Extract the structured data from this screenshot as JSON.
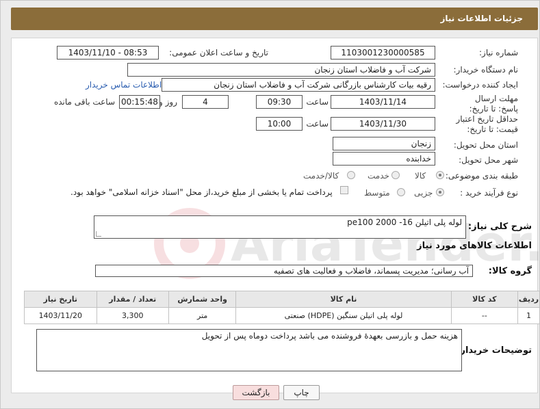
{
  "header": {
    "title": "جزئیات اطلاعات نیاز"
  },
  "fields": {
    "need_number_label": "شماره نیاز:",
    "need_number": "1103001230000585",
    "announce_label": "تاریخ و ساعت اعلان عمومی:",
    "announce_value": "1403/11/10 - 08:53",
    "buyer_label": "نام دستگاه خریدار:",
    "buyer_value": "شرکت آب و فاضلاب استان زنجان",
    "creator_label": "ایجاد کننده درخواست:",
    "creator_value": "رقیه بیات کارشناس بازرگانی شرکت آب و فاضلاب استان زنجان",
    "contact_link": "اطلاعات تماس خریدار",
    "deadline_label": "مهلت ارسال پاسخ: تا تاریخ:",
    "deadline_date": "1403/11/14",
    "time_label": "ساعت",
    "deadline_time": "09:30",
    "days_value": "4",
    "days_label": "روز و",
    "remaining_value": "00:15:48",
    "remaining_label": "ساعت باقی مانده",
    "validity_label": "حداقل تاریخ اعتبار قیمت: تا تاریخ:",
    "validity_date": "1403/11/30",
    "validity_time": "10:00",
    "province_label": "استان محل تحویل:",
    "province_value": "زنجان",
    "city_label": "شهر محل تحویل:",
    "city_value": "خدابنده",
    "category_label": "طبقه بندی موضوعی:",
    "category_options": [
      "کالا",
      "خدمت",
      "کالا/خدمت"
    ],
    "process_label": "نوع فرآیند خرید :",
    "process_options": [
      "جزیی",
      "متوسط"
    ],
    "process_note": "پرداخت تمام یا بخشی از مبلغ خرید،از محل \"اسناد خزانه اسلامی\" خواهد بود."
  },
  "description": {
    "label": "شرح کلی نیاز:",
    "text": "لوله پلی اتیلن 16- 2000 pe100"
  },
  "goods": {
    "section_title": "اطلاعات کالاهای مورد نیاز",
    "group_label": "گروه کالا:",
    "group_value": "آب رسانی؛ مدیریت پسماند، فاضلاب و فعالیت های تصفیه",
    "columns": [
      "ردیف",
      "کد کالا",
      "نام کالا",
      "واحد شمارش",
      "تعداد / مقدار",
      "تاریخ نیاز"
    ],
    "rows": [
      [
        "1",
        "--",
        "لوله پلی اتیلن سنگین (HDPE) صنعتی",
        "متر",
        "3,300",
        "1403/11/20"
      ]
    ]
  },
  "buyer_notes": {
    "label": "توضیحات خریدار:",
    "text": "هزینه حمل و بازرسی بعهدهٔ فروشنده می باشد پرداخت دوماه پس از تحویل"
  },
  "buttons": {
    "print": "چاپ",
    "back": "بازگشت"
  },
  "watermark": {
    "text": "AriaTender.neT"
  },
  "colors": {
    "header": "#8b6d3a",
    "link": "#2a5db0",
    "back_button": "#f8dede"
  }
}
